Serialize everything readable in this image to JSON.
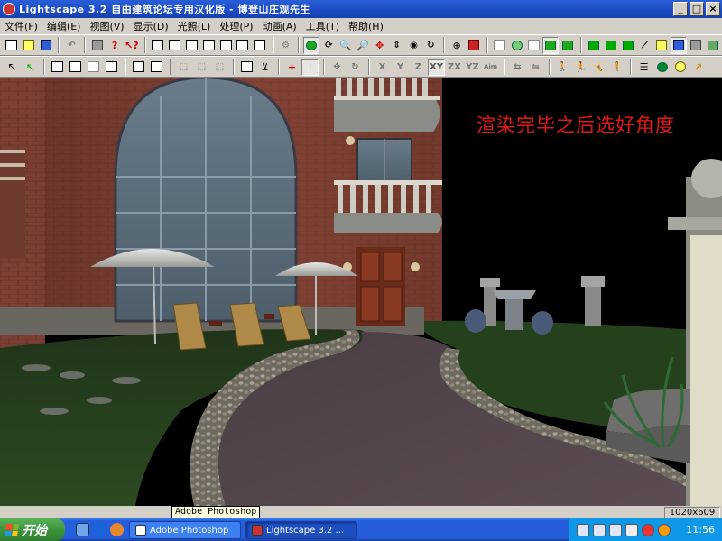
{
  "window": {
    "title": "Lightscape 3.2 自由建筑论坛专用汉化版  - 博登山庄观先生",
    "controls": {
      "minimize": "_",
      "maximize": "□",
      "close": "×"
    }
  },
  "menu": [
    "文件(F)",
    "编辑(E)",
    "视图(V)",
    "显示(D)",
    "光照(L)",
    "处理(P)",
    "动画(A)",
    "工具(T)",
    "帮助(H)"
  ],
  "toolbar2_axes": [
    "X",
    "Y",
    "Z",
    "XY",
    "ZX",
    "YZ",
    "Aim"
  ],
  "viewport": {
    "overlay_text": "渲染完毕之后选好角度",
    "overlay_color": "#e01818"
  },
  "status": {
    "resolution": "1020x609",
    "tooltip": "Adobe Photoshop"
  },
  "taskbar": {
    "start_label": "开始",
    "tasks": [
      {
        "label": "Adobe Photoshop",
        "active": false
      },
      {
        "label": "Lightscape 3.2 ...",
        "active": true
      }
    ],
    "clock": "11:56"
  }
}
